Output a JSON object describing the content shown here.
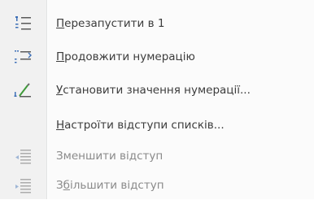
{
  "menu": {
    "items": [
      {
        "prefix": "",
        "mnemonic": "П",
        "rest": "ерезапустити в 1",
        "icon": "restart-numbering-icon",
        "enabled": true
      },
      {
        "prefix": "",
        "mnemonic": "П",
        "rest": "родовжити нумерацію",
        "icon": "continue-numbering-icon",
        "enabled": true
      },
      {
        "prefix": "",
        "mnemonic": "У",
        "rest": "становити значення нумерації...",
        "icon": "set-numbering-value-icon",
        "enabled": true
      },
      {
        "prefix": "",
        "mnemonic": "Н",
        "rest": "астроїти відступи списків...",
        "icon": "",
        "enabled": true
      },
      {
        "prefix": "",
        "mnemonic": "",
        "rest": "Зменшити відступ",
        "icon": "decrease-indent-icon",
        "enabled": false
      },
      {
        "prefix": "З",
        "mnemonic": "б",
        "rest": "ільшити відступ",
        "icon": "increase-indent-icon",
        "enabled": false
      }
    ]
  },
  "colors": {
    "gutter": "#f1f1f1",
    "menu_background": "#fbfbfb",
    "text": "#3c3c3c",
    "text_disabled": "#8a8a8a",
    "icon_blue": "#3d6fb6",
    "icon_green": "#3f9a3a"
  }
}
